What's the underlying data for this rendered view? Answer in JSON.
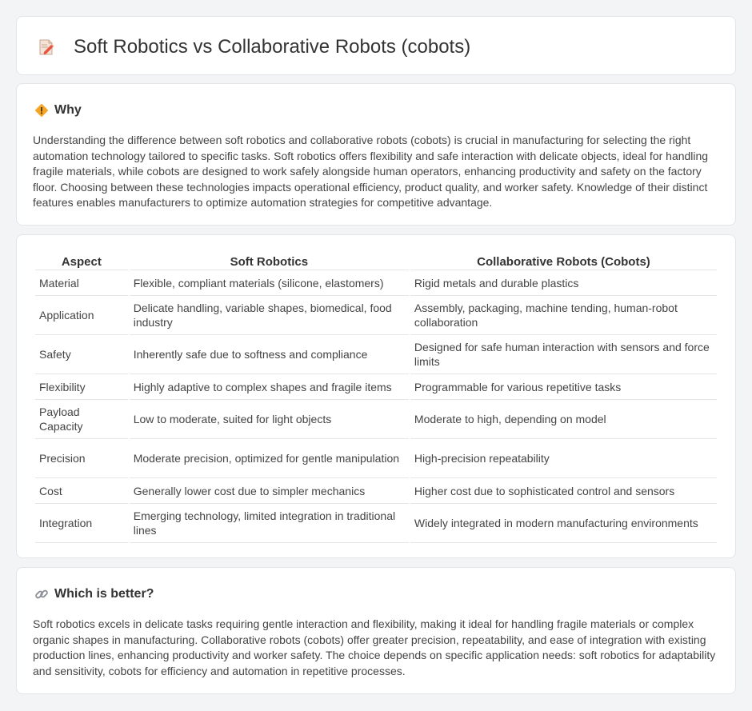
{
  "header": {
    "title": "Soft Robotics vs Collaborative Robots (cobots)",
    "icon": "document-pencil-icon"
  },
  "why": {
    "title": "Why",
    "icon": "diamond-warning-icon",
    "body": "Understanding the difference between soft robotics and collaborative robots (cobots) is crucial in manufacturing for selecting the right automation technology tailored to specific tasks. Soft robotics offers flexibility and safe interaction with delicate objects, ideal for handling fragile materials, while cobots are designed to work safely alongside human operators, enhancing productivity and safety on the factory floor. Choosing between these technologies impacts operational efficiency, product quality, and worker safety. Knowledge of their distinct features enables manufacturers to optimize automation strategies for competitive advantage."
  },
  "table": {
    "headers": [
      "Aspect",
      "Soft Robotics",
      "Collaborative Robots (Cobots)"
    ],
    "rows": [
      [
        "Material",
        "Flexible, compliant materials (silicone, elastomers)",
        "Rigid metals and durable plastics"
      ],
      [
        "Application",
        "Delicate handling, variable shapes, biomedical, food industry",
        "Assembly, packaging, machine tending, human-robot collaboration"
      ],
      [
        "Safety",
        "Inherently safe due to softness and compliance",
        "Designed for safe human interaction with sensors and force limits"
      ],
      [
        "Flexibility",
        "Highly adaptive to complex shapes and fragile items",
        "Programmable for various repetitive tasks"
      ],
      [
        "Payload Capacity",
        "Low to moderate, suited for light objects",
        "Moderate to high, depending on model"
      ],
      [
        "Precision",
        "Moderate precision, optimized for gentle manipulation",
        "High-precision repeatability"
      ],
      [
        "Cost",
        "Generally lower cost due to simpler mechanics",
        "Higher cost due to sophisticated control and sensors"
      ],
      [
        "Integration",
        "Emerging technology, limited integration in traditional lines",
        "Widely integrated in modern manufacturing environments"
      ]
    ]
  },
  "better": {
    "title": "Which is better?",
    "icon": "link-icon",
    "body": "Soft robotics excels in delicate tasks requiring gentle interaction and flexibility, making it ideal for handling fragile materials or complex organic shapes in manufacturing. Collaborative robots (cobots) offer greater precision, repeatability, and ease of integration with existing production lines, enhancing productivity and worker safety. The choice depends on specific application needs: soft robotics for adaptability and sensitivity, cobots for efficiency and automation in repetitive processes."
  }
}
